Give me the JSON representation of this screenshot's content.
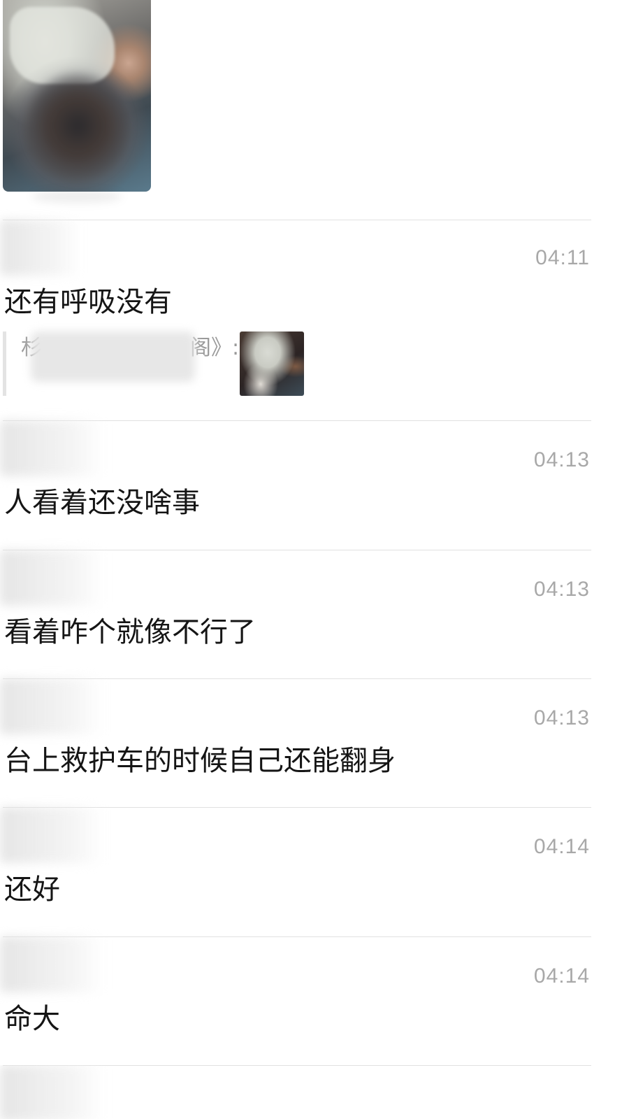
{
  "top_image": {
    "description_icon": "photo-thumbnail"
  },
  "messages": [
    {
      "time": "04:11",
      "text": "还有呼吸没有",
      "quote": {
        "prefix": "杉",
        "suffix": "阁》:"
      }
    },
    {
      "time": "04:13",
      "text": "人看着还没啥事"
    },
    {
      "time": "04:13",
      "text": "看着咋个就像不行了"
    },
    {
      "time": "04:13",
      "text": "台上救护车的时候自己还能翻身"
    },
    {
      "time": "04:14",
      "text": "还好"
    },
    {
      "time": "04:14",
      "text": "命大"
    }
  ]
}
